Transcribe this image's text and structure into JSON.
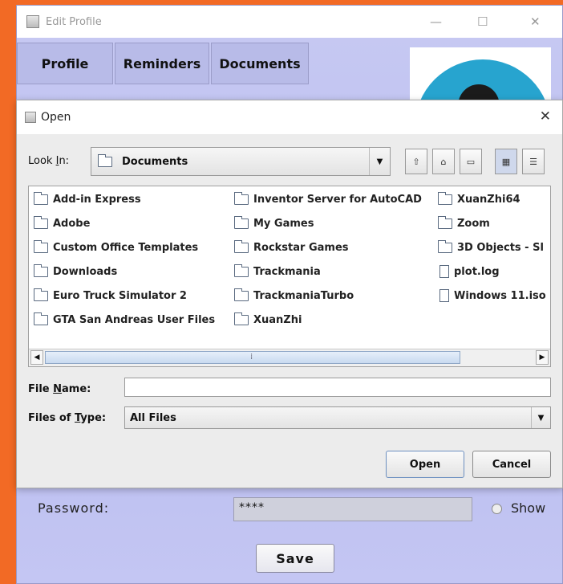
{
  "back_window": {
    "title": "Edit Profile",
    "controls": {
      "minimize": "—",
      "maximize": "☐",
      "close": "✕"
    },
    "tabs": [
      "Profile",
      "Reminders",
      "Documents"
    ],
    "password_label": "Password:",
    "password_value": "****",
    "show_label": "Show",
    "save_label": "Save"
  },
  "dialog": {
    "title": "Open",
    "close": "✕",
    "look_in": {
      "label_pre": "Look ",
      "label_mnemonic": "I",
      "label_post": "n:",
      "value": "Documents"
    },
    "toolbar_icons": [
      "up-folder-icon",
      "home-icon",
      "new-folder-icon",
      "list-view-icon",
      "details-view-icon"
    ],
    "files": [
      {
        "name": "Add-in Express",
        "icon": "folder-icon"
      },
      {
        "name": "Adobe",
        "icon": "folder-icon"
      },
      {
        "name": "Custom Office Templates",
        "icon": "folder-icon"
      },
      {
        "name": "Downloads",
        "icon": "folder-icon"
      },
      {
        "name": "Euro Truck Simulator 2",
        "icon": "folder-icon"
      },
      {
        "name": "GTA San Andreas User Files",
        "icon": "folder-icon"
      },
      {
        "name": "Inventor Server for AutoCAD",
        "icon": "folder-icon"
      },
      {
        "name": "My Games",
        "icon": "folder-icon"
      },
      {
        "name": "Rockstar Games",
        "icon": "folder-icon"
      },
      {
        "name": "Trackmania",
        "icon": "folder-icon"
      },
      {
        "name": "TrackmaniaTurbo",
        "icon": "folder-icon"
      },
      {
        "name": "XuanZhi",
        "icon": "folder-icon"
      },
      {
        "name": "XuanZhi64",
        "icon": "folder-icon"
      },
      {
        "name": "Zoom",
        "icon": "folder-icon"
      },
      {
        "name": "3D Objects - Sl",
        "icon": "folder-icon"
      },
      {
        "name": "plot.log",
        "icon": "file-icon"
      },
      {
        "name": "Windows 11.iso",
        "icon": "file-icon"
      }
    ],
    "file_name": {
      "label_pre": "File ",
      "label_mnemonic": "N",
      "label_post": "ame:",
      "value": ""
    },
    "files_of_type": {
      "label_pre": "Files of ",
      "label_mnemonic": "T",
      "label_post": "ype:",
      "value": "All Files"
    },
    "open_label": "Open",
    "cancel_label": "Cancel"
  }
}
